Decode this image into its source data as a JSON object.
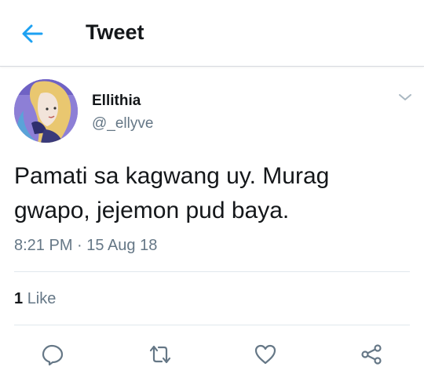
{
  "header": {
    "title": "Tweet",
    "back_icon": "arrow-left-icon",
    "accent": "#1da1f2"
  },
  "tweet": {
    "author": {
      "name": "Ellithia",
      "handle": "@_ellyve"
    },
    "text_line1": "Pamati sa kagwang uy. Murag",
    "text_line2": "gwapo, jejemon pud baya.",
    "timestamp": "8:21 PM · 15 Aug 18",
    "likes": {
      "count": "1",
      "label": "Like"
    }
  },
  "actions": [
    {
      "name": "reply",
      "icon": "reply-icon"
    },
    {
      "name": "retweet",
      "icon": "retweet-icon"
    },
    {
      "name": "like",
      "icon": "heart-icon"
    },
    {
      "name": "share",
      "icon": "share-icon"
    }
  ],
  "colors": {
    "text": "#14171a",
    "secondary": "#657786",
    "divider": "#e1e8ed"
  }
}
